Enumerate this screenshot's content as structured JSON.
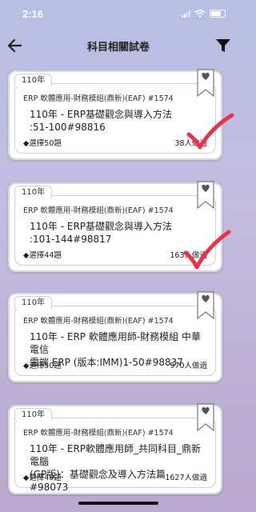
{
  "status_bar": {
    "time": "2:16"
  },
  "header": {
    "title": "科目相關試卷"
  },
  "colors": {
    "check": "#e8334a",
    "accent": "#222222"
  },
  "cards": [
    {
      "year": "110年",
      "subject": "ERP 軟體應用-財務模組(鼎新)(EAF) #1574",
      "title_line1": "110年 - ERP基礎觀念與導入方法",
      "title_line2": ":51-100#98816",
      "question_count": "◆選擇50題",
      "takers": "38人做過",
      "completed": true
    },
    {
      "year": "110年",
      "subject": "ERP 軟體應用-財務模組(鼎新)(EAF) #1574",
      "title_line1": "110年 - ERP基礎觀念與導入方法",
      "title_line2": ":101-144#98817",
      "question_count": "◆選擇44題",
      "takers": "163人做過",
      "completed": true
    },
    {
      "year": "110年",
      "subject": "ERP 軟體應用-財務模組(鼎新)(EAF) #1574",
      "title_line1": "110年 - ERP 軟體應用師-財務模組 中華電信",
      "title_line2": "雲端 ERP (版本:IMM)1-50#98837",
      "question_count": "◆選擇50題",
      "takers": "970人做過",
      "completed": false
    },
    {
      "year": "110年",
      "subject": "ERP 軟體應用-財務模組(鼎新)(EAF) #1574",
      "title_line1": "110年 - ERP軟體應用師_共同科目_鼎新電腦",
      "title_line2": "(GP版)：基礎觀念及導入方法篇#98073",
      "question_count": "◆選擇49題",
      "takers": "1627人做過",
      "completed": false
    }
  ]
}
